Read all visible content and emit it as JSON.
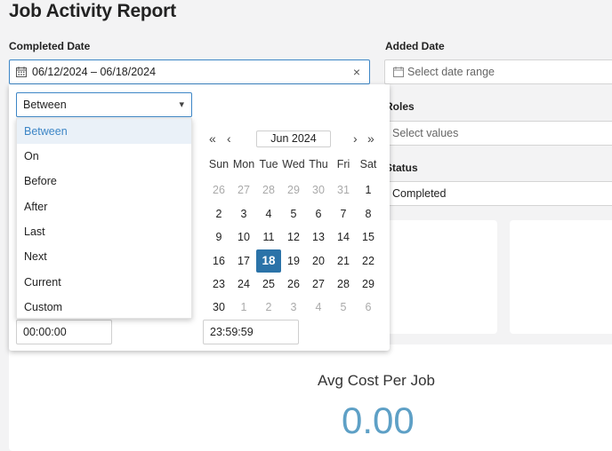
{
  "page": {
    "title": "Job Activity Report"
  },
  "completed_date": {
    "label": "Completed Date",
    "value": "06/12/2024 – 06/18/2024",
    "clear": "×"
  },
  "added_date": {
    "label": "Added Date",
    "placeholder": "Select date range"
  },
  "roles": {
    "label": "Roles",
    "placeholder": "Select values"
  },
  "status": {
    "label": "Status",
    "value": "Completed"
  },
  "mode_select": {
    "value": "Between",
    "arrow": "▾",
    "options": [
      "Between",
      "On",
      "Before",
      "After",
      "Last",
      "Next",
      "Current",
      "Custom"
    ]
  },
  "calendar": {
    "month": "Jun 2024",
    "nav": {
      "prev_year": "«",
      "prev_month": "‹",
      "next_month": "›",
      "next_year": "»"
    },
    "weekdays": [
      "Sun",
      "Mon",
      "Tue",
      "Wed",
      "Thu",
      "Fri",
      "Sat"
    ],
    "weeks": [
      [
        "26",
        "27",
        "28",
        "29",
        "30",
        "31",
        "1"
      ],
      [
        "2",
        "3",
        "4",
        "5",
        "6",
        "7",
        "8"
      ],
      [
        "9",
        "10",
        "11",
        "12",
        "13",
        "14",
        "15"
      ],
      [
        "16",
        "17",
        "18",
        "19",
        "20",
        "21",
        "22"
      ],
      [
        "23",
        "24",
        "25",
        "26",
        "27",
        "28",
        "29"
      ],
      [
        "30",
        "1",
        "2",
        "3",
        "4",
        "5",
        "6"
      ]
    ],
    "selected_day": "18"
  },
  "time": {
    "start": "00:00:00",
    "end": "23:59:59"
  },
  "avg_cost": {
    "title": "Avg Cost Per Job",
    "value": "0.00"
  },
  "colors": {
    "accent": "#2b73a8",
    "value_blue": "#5ea0c6"
  },
  "icons": {
    "calendar": "calendar-icon"
  }
}
